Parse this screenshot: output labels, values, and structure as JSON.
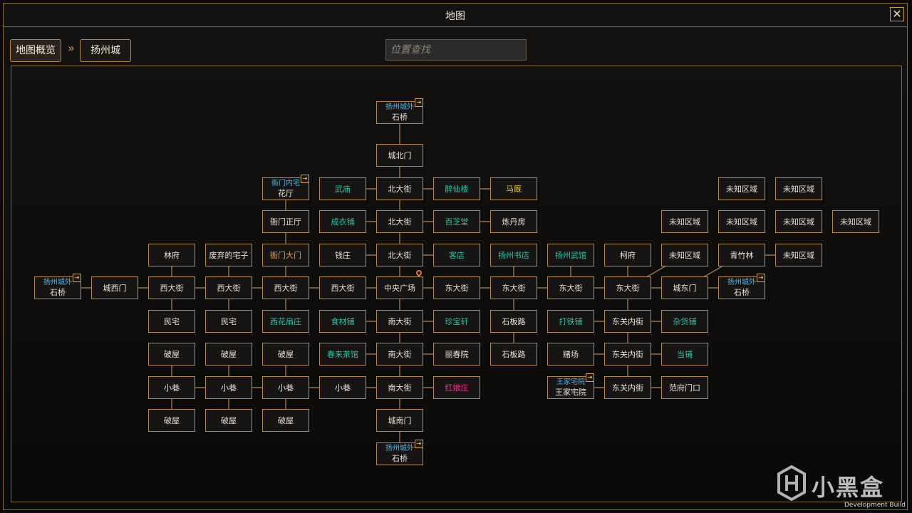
{
  "window": {
    "title": "地图"
  },
  "breadcrumb": {
    "overview": "地图概览",
    "separator": "»",
    "current": "扬州城"
  },
  "search": {
    "placeholder": "位置查找"
  },
  "colors": {
    "border": "#b08a52",
    "sublabel": "#4fb4e8",
    "teal": "#27c4a4",
    "yellow": "#e6c436",
    "orange": "#e8a24a",
    "pink": "#e63a8e"
  },
  "nodes": [
    {
      "id": "n-stonebridge-n",
      "label": "石桥",
      "sub": "扬州城外",
      "exit": true
    },
    {
      "id": "n-north-gate",
      "label": "城北门"
    },
    {
      "id": "n-yamen-inner",
      "label": "花厅",
      "sub": "衙门内宅",
      "exit": true
    },
    {
      "id": "n-wumiao",
      "label": "武庙",
      "color": "teal"
    },
    {
      "id": "n-north-st-1",
      "label": "北大街"
    },
    {
      "id": "n-zuixian",
      "label": "醉仙楼",
      "color": "teal"
    },
    {
      "id": "n-stable",
      "label": "马厩",
      "color": "yellow"
    },
    {
      "id": "n-unknown-1",
      "label": "未知区域"
    },
    {
      "id": "n-unknown-2",
      "label": "未知区域"
    },
    {
      "id": "n-yamen-hall",
      "label": "衙门正厅"
    },
    {
      "id": "n-tailor",
      "label": "成衣铺",
      "color": "teal"
    },
    {
      "id": "n-north-st-2",
      "label": "北大街"
    },
    {
      "id": "n-baizhi",
      "label": "百芝堂",
      "color": "teal"
    },
    {
      "id": "n-alchemy",
      "label": "炼丹房"
    },
    {
      "id": "n-unknown-3",
      "label": "未知区域"
    },
    {
      "id": "n-unknown-4",
      "label": "未知区域"
    },
    {
      "id": "n-unknown-5",
      "label": "未知区域"
    },
    {
      "id": "n-unknown-6",
      "label": "未知区域"
    },
    {
      "id": "n-linfu",
      "label": "林府"
    },
    {
      "id": "n-abandoned",
      "label": "废弃的宅子"
    },
    {
      "id": "n-yamen-gate",
      "label": "衙门大门",
      "color": "orange"
    },
    {
      "id": "n-bank",
      "label": "钱庄"
    },
    {
      "id": "n-north-st-3",
      "label": "北大街"
    },
    {
      "id": "n-inn",
      "label": "客店",
      "color": "teal"
    },
    {
      "id": "n-bookstore",
      "label": "扬州书店",
      "color": "teal"
    },
    {
      "id": "n-martial-hall",
      "label": "扬州武馆",
      "color": "teal"
    },
    {
      "id": "n-kefu",
      "label": "柯府"
    },
    {
      "id": "n-unknown-7",
      "label": "未知区域"
    },
    {
      "id": "n-bamboo",
      "label": "青竹林"
    },
    {
      "id": "n-unknown-8",
      "label": "未知区域"
    },
    {
      "id": "n-stonebridge-w",
      "label": "石桥",
      "sub": "扬州城外",
      "exit": true
    },
    {
      "id": "n-west-gate",
      "label": "城西门"
    },
    {
      "id": "n-west-st-1",
      "label": "西大街"
    },
    {
      "id": "n-west-st-2",
      "label": "西大街"
    },
    {
      "id": "n-west-st-3",
      "label": "西大街"
    },
    {
      "id": "n-west-st-4",
      "label": "西大街"
    },
    {
      "id": "n-central-square",
      "label": "中央广场",
      "pin": true
    },
    {
      "id": "n-east-st-1",
      "label": "东大街"
    },
    {
      "id": "n-east-st-2",
      "label": "东大街"
    },
    {
      "id": "n-east-st-3",
      "label": "东大街"
    },
    {
      "id": "n-east-st-4",
      "label": "东大街"
    },
    {
      "id": "n-east-gate",
      "label": "城东门"
    },
    {
      "id": "n-stonebridge-e",
      "label": "石桥",
      "sub": "扬州城外",
      "exit": true
    },
    {
      "id": "n-house-1",
      "label": "民宅"
    },
    {
      "id": "n-house-2",
      "label": "民宅"
    },
    {
      "id": "n-fan-shop",
      "label": "西花扇庄",
      "color": "teal"
    },
    {
      "id": "n-food-shop",
      "label": "食材铺",
      "color": "teal"
    },
    {
      "id": "n-south-st-1",
      "label": "南大街"
    },
    {
      "id": "n-zhenbao",
      "label": "珍宝轩",
      "color": "teal"
    },
    {
      "id": "n-slate-road-1",
      "label": "石板路"
    },
    {
      "id": "n-smithy",
      "label": "打铁铺",
      "color": "teal"
    },
    {
      "id": "n-east-inner-1",
      "label": "东关内街"
    },
    {
      "id": "n-grocery",
      "label": "杂货铺",
      "color": "teal"
    },
    {
      "id": "n-ruin-1",
      "label": "破屋"
    },
    {
      "id": "n-ruin-2",
      "label": "破屋"
    },
    {
      "id": "n-ruin-3",
      "label": "破屋"
    },
    {
      "id": "n-teahouse",
      "label": "春来茶馆",
      "color": "teal"
    },
    {
      "id": "n-south-st-2",
      "label": "南大街"
    },
    {
      "id": "n-lichun",
      "label": "丽春院"
    },
    {
      "id": "n-slate-road-2",
      "label": "石板路"
    },
    {
      "id": "n-casino",
      "label": "赌场"
    },
    {
      "id": "n-east-inner-2",
      "label": "东关内街"
    },
    {
      "id": "n-pawnshop",
      "label": "当铺",
      "color": "teal"
    },
    {
      "id": "n-alley-1",
      "label": "小巷"
    },
    {
      "id": "n-alley-2",
      "label": "小巷"
    },
    {
      "id": "n-alley-3",
      "label": "小巷"
    },
    {
      "id": "n-alley-4",
      "label": "小巷"
    },
    {
      "id": "n-south-st-3",
      "label": "南大街"
    },
    {
      "id": "n-hongniang",
      "label": "红娘庄",
      "color": "pink"
    },
    {
      "id": "n-wang-house",
      "label": "王家宅院",
      "sub": "王家宅院",
      "exit": true
    },
    {
      "id": "n-east-inner-3",
      "label": "东关内街"
    },
    {
      "id": "n-fan-gate",
      "label": "范府门口"
    },
    {
      "id": "n-ruin-4",
      "label": "破屋"
    },
    {
      "id": "n-ruin-5",
      "label": "破屋"
    },
    {
      "id": "n-ruin-6",
      "label": "破屋"
    },
    {
      "id": "n-south-gate",
      "label": "城南门"
    },
    {
      "id": "n-stonebridge-s",
      "label": "石桥",
      "sub": "扬州城外",
      "exit": true
    }
  ],
  "footer": {
    "watermark": "小黑盒",
    "build": "Development Build"
  }
}
